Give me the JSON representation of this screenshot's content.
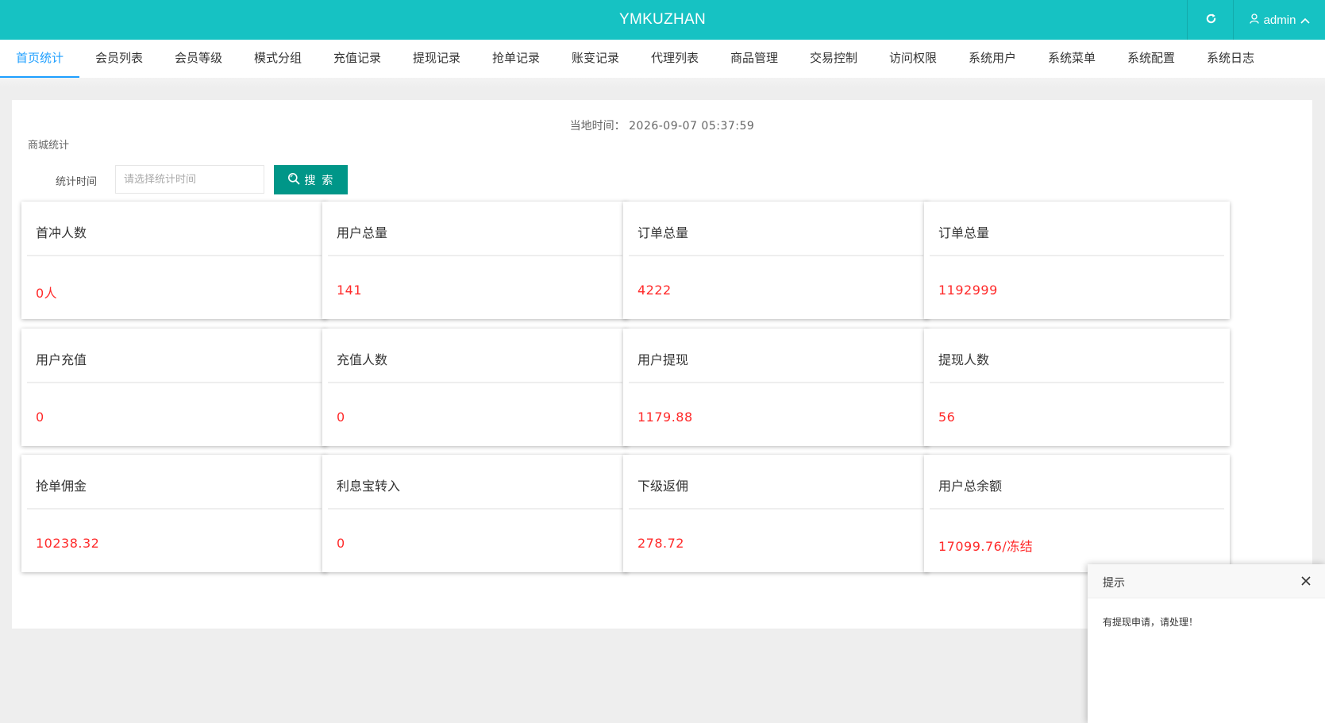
{
  "header": {
    "title": "YMKUZHAN",
    "user": "admin",
    "refresh_icon": "refresh-icon",
    "user_icon": "user-icon",
    "caret_icon": "chevron-up-icon"
  },
  "tabs": [
    {
      "label": "首页统计",
      "active": true
    },
    {
      "label": "会员列表"
    },
    {
      "label": "会员等级"
    },
    {
      "label": "模式分组"
    },
    {
      "label": "充值记录"
    },
    {
      "label": "提现记录"
    },
    {
      "label": "抢单记录"
    },
    {
      "label": "账变记录"
    },
    {
      "label": "代理列表"
    },
    {
      "label": "商品管理"
    },
    {
      "label": "交易控制"
    },
    {
      "label": "访问权限"
    },
    {
      "label": "系统用户"
    },
    {
      "label": "系统菜单"
    },
    {
      "label": "系统配置"
    },
    {
      "label": "系统日志"
    }
  ],
  "main": {
    "local_time_label": "当地时间：",
    "local_time_value": "2026-09-07 05:37:59",
    "section_title": "商城统计",
    "filter_label": "统计时间",
    "filter_placeholder": "请选择统计时间",
    "search_label": "搜 索"
  },
  "cards": [
    {
      "label": "首冲人数",
      "value": "0人"
    },
    {
      "label": "用户总量",
      "value": "141"
    },
    {
      "label": "订单总量",
      "value": "4222"
    },
    {
      "label": "订单总量",
      "value": "1192999"
    },
    {
      "label": "用户充值",
      "value": "0"
    },
    {
      "label": "充值人数",
      "value": "0"
    },
    {
      "label": "用户提现",
      "value": "1179.88"
    },
    {
      "label": "提现人数",
      "value": "56"
    },
    {
      "label": "抢单佣金",
      "value": "10238.32"
    },
    {
      "label": "利息宝转入",
      "value": "0"
    },
    {
      "label": "下级返佣",
      "value": "278.72"
    },
    {
      "label": "用户总余额",
      "value": "17099.76/冻结"
    }
  ],
  "toast": {
    "title": "提示",
    "message": "有提现申请，请处理！"
  },
  "colors": {
    "header_bg": "#16c2c3",
    "active_tab": "#1e9fff",
    "search_button": "#009688",
    "value_red": "#ff2a2a"
  }
}
